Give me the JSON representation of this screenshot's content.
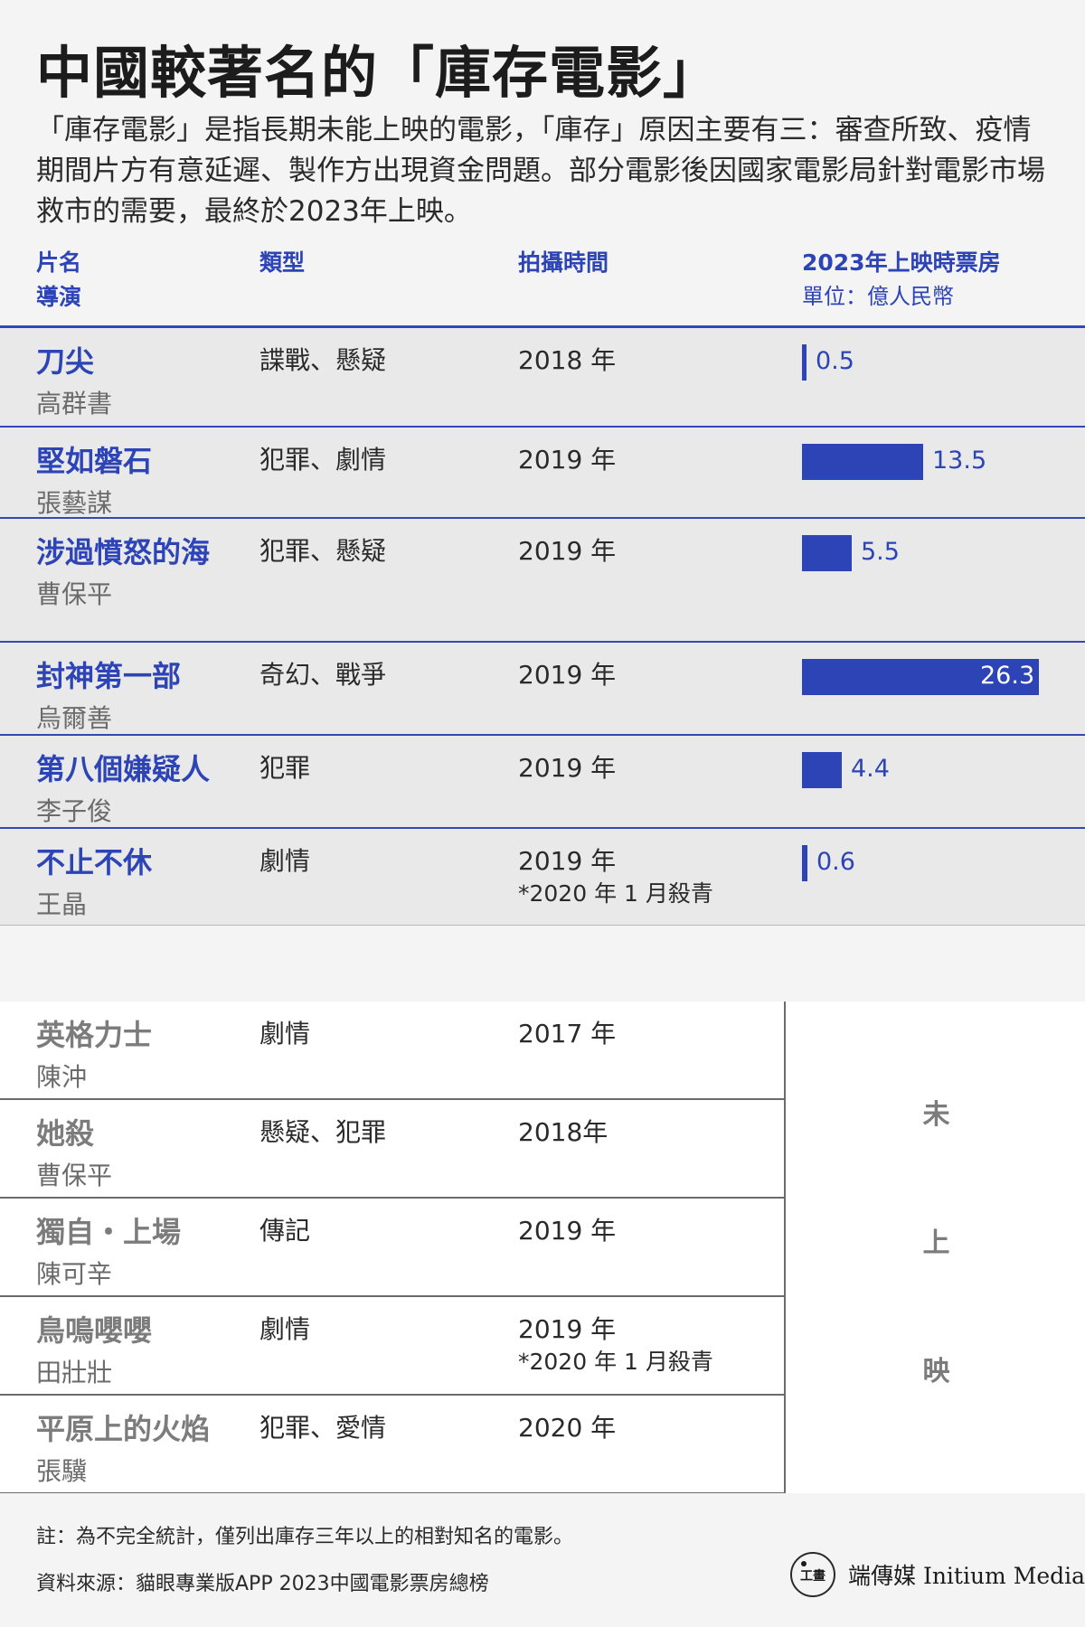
{
  "title": "中國較著名的「庫存電影」",
  "intro": "「庫存電影」是指長期未能上映的電影，「庫存」原因主要有三：審查所致、疫情期間片方有意延遲、製作方出現資金問題。部分電影後因國家電影局針對電影市場救市的需要，最終於2023年上映。",
  "header": {
    "col1_line1": "片名",
    "col1_line2": "導演",
    "col2": "類型",
    "col3": "拍攝時間",
    "col4": "2023年上映時票房",
    "col4_unit": "單位：億人民幣"
  },
  "released": [
    {
      "title": "刀尖",
      "director": "高群書",
      "genre": "諜戰、懸疑",
      "year": "2018 年",
      "note": "",
      "box_label": "0.5"
    },
    {
      "title": "堅如磐石",
      "director": "張藝謀",
      "genre": "犯罪、劇情",
      "year": "2019 年",
      "note": "",
      "box_label": "13.5"
    },
    {
      "title": "涉過憤怒的海",
      "director": "曹保平",
      "genre": "犯罪、懸疑",
      "year": "2019 年",
      "note": "",
      "box_label": "5.5"
    },
    {
      "title": "封神第一部",
      "director": "烏爾善",
      "genre": "奇幻、戰爭",
      "year": "2019 年",
      "note": "",
      "box_label": "26.3"
    },
    {
      "title": "第八個嫌疑人",
      "director": "李子俊",
      "genre": "犯罪",
      "year": "2019 年",
      "note": "",
      "box_label": "4.4"
    },
    {
      "title": "不止不休",
      "director": "王晶",
      "genre": "劇情",
      "year": "2019 年",
      "note": "*2020 年 1 月殺青",
      "box_label": "0.6"
    }
  ],
  "unreleased": [
    {
      "title": "英格力士",
      "director": "陳沖",
      "genre": "劇情",
      "year": "2017 年",
      "note": ""
    },
    {
      "title": "她殺",
      "director": "曹保平",
      "genre": "懸疑、犯罪",
      "year": "2018年",
      "note": ""
    },
    {
      "title": "獨自・上場",
      "director": "陳可辛",
      "genre": "傳記",
      "year": "2019 年",
      "note": ""
    },
    {
      "title": "鳥鳴嚶嚶",
      "director": "田壯壯",
      "genre": "劇情",
      "year": "2019 年",
      "note": "*2020 年 1 月殺青"
    },
    {
      "title": "平原上的火焰",
      "director": "張驥",
      "genre": "犯罪、愛情",
      "year": "2020 年",
      "note": ""
    }
  ],
  "unreleased_side": [
    "未",
    "上",
    "映"
  ],
  "footnote": "註：為不完全統計，僅列出庫存三年以上的相對知名的電影。",
  "source": "資料來源：貓眼專業版APP 2023中國電影票房總榜",
  "brand": "端傳媒 Initium Media",
  "logo_text": "工畫",
  "colors": {
    "accent": "#2d44b6",
    "released_bg": "#e9e9e9",
    "unreleased_title": "#7c7c7c"
  },
  "chart_data": {
    "type": "bar",
    "orientation": "horizontal",
    "title": "2023年上映時票房",
    "ylabel": "單位：億人民幣",
    "categories": [
      "刀尖",
      "堅如磐石",
      "涉過憤怒的海",
      "封神第一部",
      "第八個嫌疑人",
      "不止不休"
    ],
    "values": [
      0.5,
      13.5,
      5.5,
      26.3,
      4.4,
      0.6
    ],
    "xlim": [
      0,
      26.3
    ]
  }
}
